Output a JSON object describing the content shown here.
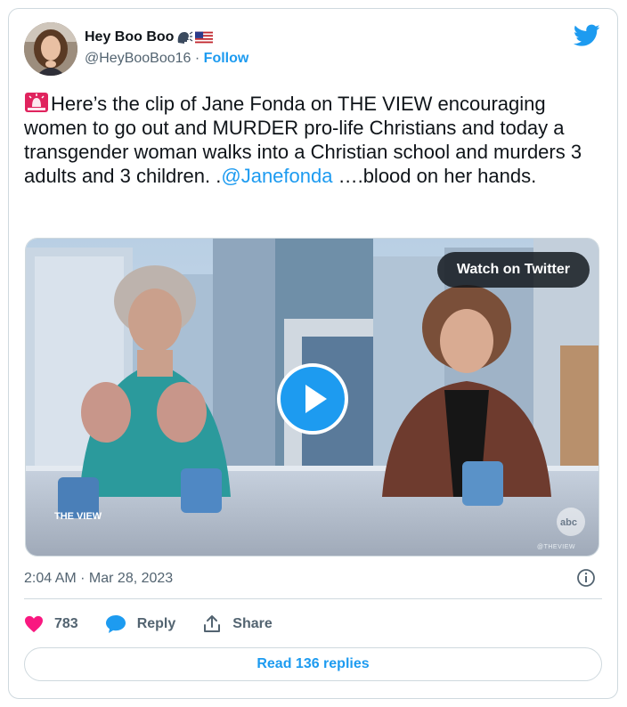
{
  "author": {
    "display_name": "Hey Boo Boo",
    "handle": "@HeyBooBoo16",
    "separator": "·",
    "follow_label": "Follow",
    "badges": [
      "speaking-head-emoji",
      "us-flag-emoji"
    ]
  },
  "tweet": {
    "siren_icon": "rotating-light-emoji",
    "text_before_mention": "Here’s the clip of Jane Fonda on THE VIEW encouraging women to go out and MURDER pro-life Christians and today a transgender woman walks into a Christian school and murders 3 adults and 3 children. .",
    "mention": "@Janefonda",
    "text_after_mention": " ….blood on her hands."
  },
  "media": {
    "watch_label": "Watch on Twitter",
    "play_icon": "play-icon",
    "show_logo": "THE VIEW",
    "network_logo": "abc",
    "watermark": "@THEVIEW"
  },
  "meta": {
    "timestamp": "2:04 AM · Mar 28, 2023"
  },
  "actions": {
    "like_count": "783",
    "reply_label": "Reply",
    "share_label": "Share"
  },
  "read_replies_label": "Read 136 replies",
  "colors": {
    "accent": "#1d9bf0",
    "like": "#f91880",
    "text": "#0f1419",
    "muted": "#536471",
    "border": "#cfd9de"
  }
}
